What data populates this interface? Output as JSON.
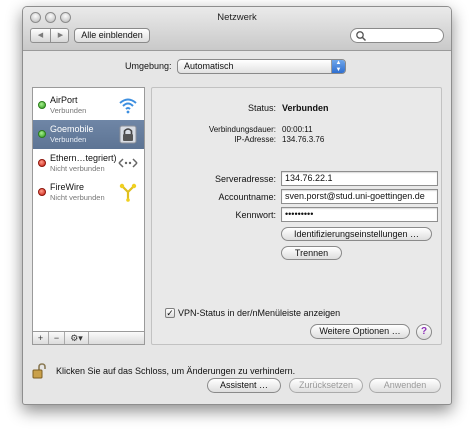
{
  "window": {
    "title": "Netzwerk"
  },
  "toolbar": {
    "show_all_label": "Alle einblenden",
    "back_icon": "◀",
    "forward_icon": "▶",
    "search_placeholder": ""
  },
  "location": {
    "label": "Umgebung:",
    "value": "Automatisch"
  },
  "services": [
    {
      "name": "AirPort",
      "status": "Verbunden",
      "status_color": "green",
      "icon": "wifi-icon"
    },
    {
      "name": "Goemobile",
      "status": "Verbunden",
      "status_color": "green",
      "icon": "vpn-lock-icon",
      "selected": true
    },
    {
      "name": "Ethern…tegriert)",
      "status": "Nicht verbunden",
      "status_color": "red",
      "icon": "ethernet-icon"
    },
    {
      "name": "FireWire",
      "status": "Nicht verbunden",
      "status_color": "red",
      "icon": "firewire-icon"
    }
  ],
  "sidebar_tools": {
    "add": "+",
    "remove": "−",
    "gear": "⚙▾"
  },
  "detail": {
    "status_label": "Status:",
    "status_value": "Verbunden",
    "duration_label": "Verbindungsdauer:",
    "duration_value": "00:00:11",
    "ip_label": "IP-Adresse:",
    "ip_value": "134.76.3.76",
    "server_label": "Serveradresse:",
    "server_value": "134.76.22.1",
    "account_label": "Accountname:",
    "account_value": "sven.porst@stud.uni-goettingen.de",
    "password_label": "Kennwort:",
    "password_value": "•••••••••",
    "auth_button": "Identifizierungseinstellungen …",
    "disconnect_button": "Trennen",
    "vpn_status_checkbox": "VPN-Status in der/nMenüleiste anzeigen",
    "vpn_status_checked": true,
    "more_options_button": "Weitere Optionen …",
    "help_button": "?"
  },
  "footer": {
    "lock_text": "Klicken Sie auf das Schloss, um Änderungen zu verhindern.",
    "assistant_button": "Assistent …",
    "revert_button": "Zurücksetzen",
    "apply_button": "Anwenden"
  },
  "colors": {
    "selection": "#647b9b",
    "green_status": "#3aa52a",
    "red_status": "#d0231a",
    "help_accent": "#8d2fb8"
  }
}
